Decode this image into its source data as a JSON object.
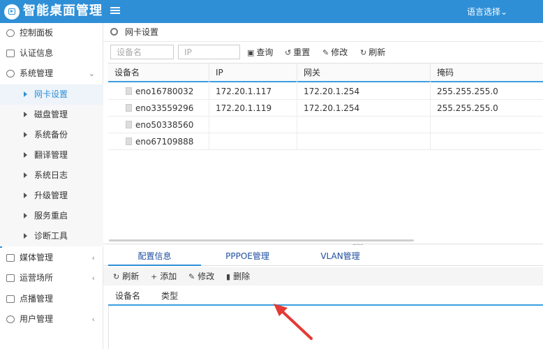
{
  "header": {
    "app_title": "智能桌面管理",
    "lang_select": "语言选择",
    "lang_caret": "⌄"
  },
  "sidebar": {
    "items": [
      {
        "label": "控制面板",
        "icon": "dashboard-icon"
      },
      {
        "label": "认证信息",
        "icon": "id-card-icon"
      },
      {
        "label": "系统管理",
        "icon": "gear-icon",
        "caret": "⌄"
      },
      {
        "label": "媒体管理",
        "icon": "monitor-icon",
        "caret": "‹"
      },
      {
        "label": "运营场所",
        "icon": "building-icon",
        "caret": "‹"
      },
      {
        "label": "点播管理",
        "icon": "play-icon"
      },
      {
        "label": "用户管理",
        "icon": "users-icon",
        "caret": "‹"
      }
    ],
    "sub_items": [
      {
        "label": "网卡设置",
        "active": true
      },
      {
        "label": "磁盘管理"
      },
      {
        "label": "系统备份"
      },
      {
        "label": "翻译管理"
      },
      {
        "label": "系统日志"
      },
      {
        "label": "升级管理"
      },
      {
        "label": "服务重启"
      },
      {
        "label": "诊断工具"
      }
    ]
  },
  "breadcrumb": {
    "label": "网卡设置"
  },
  "toolbar": {
    "device_placeholder": "设备名",
    "ip_placeholder": "IP",
    "query": "查询",
    "reset": "重置",
    "edit": "修改",
    "refresh": "刷新"
  },
  "table": {
    "columns": [
      "设备名",
      "IP",
      "网关",
      "掩码"
    ],
    "rows": [
      [
        "eno16780032",
        "172.20.1.117",
        "172.20.1.254",
        "255.255.255.0"
      ],
      [
        "eno33559296",
        "172.20.1.119",
        "172.20.1.254",
        "255.255.255.0"
      ],
      [
        "eno50338560",
        "",
        "",
        ""
      ],
      [
        "eno67109888",
        "",
        "",
        ""
      ]
    ]
  },
  "tabs": [
    {
      "label": "配置信息",
      "active": true
    },
    {
      "label": "PPPOE管理"
    },
    {
      "label": "VLAN管理"
    }
  ],
  "toolbar2": {
    "refresh": "刷新",
    "add": "添加",
    "edit": "修改",
    "delete": "删除"
  },
  "table2": {
    "columns": [
      "设备名",
      "类型"
    ]
  },
  "colors": {
    "header_bg": "#2f8fd6",
    "accent": "#3a9fe0",
    "tab_text": "#1f4fa0",
    "annotation_arrow": "#e53935"
  }
}
